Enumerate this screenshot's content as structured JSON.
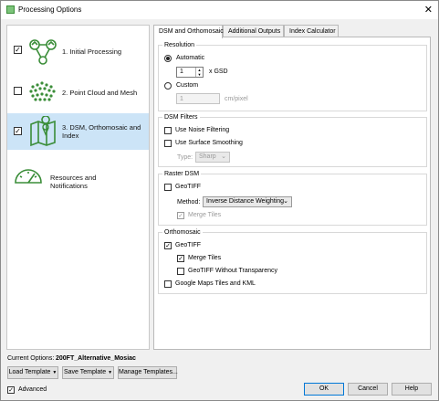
{
  "window": {
    "title": "Processing Options",
    "close_label": "✕"
  },
  "sidebar": {
    "items": [
      {
        "label": "1. Initial Processing",
        "checked": "✓"
      },
      {
        "label": "2. Point Cloud and Mesh",
        "checked": ""
      },
      {
        "label": "3. DSM, Orthomosaic and Index",
        "checked": "✓"
      },
      {
        "label": "Resources and Notifications"
      }
    ]
  },
  "tabs": [
    {
      "label": "DSM and Orthomosaic"
    },
    {
      "label": "Additional Outputs"
    },
    {
      "label": "Index Calculator"
    }
  ],
  "resolution": {
    "title": "Resolution",
    "automatic_label": "Automatic",
    "gsd_value": "1",
    "gsd_unit": "x GSD",
    "custom_label": "Custom",
    "custom_value": "1",
    "custom_unit": "cm/pixel"
  },
  "dsm_filters": {
    "title": "DSM Filters",
    "noise_label": "Use Noise Filtering",
    "smoothing_label": "Use Surface Smoothing",
    "type_label": "Type:",
    "type_value": "Sharp"
  },
  "raster_dsm": {
    "title": "Raster DSM",
    "geotiff_label": "GeoTIFF",
    "method_label": "Method:",
    "method_value": "Inverse Distance Weighting",
    "merge_label": "Merge Tiles"
  },
  "orthomosaic": {
    "title": "Orthomosaic",
    "geotiff_label": "GeoTIFF",
    "merge_label": "Merge Tiles",
    "no_transparency_label": "GeoTIFF Without Transparency",
    "google_label": "Google Maps Tiles and KML"
  },
  "footer": {
    "current_options_label": "Current Options:",
    "current_options_value": "200FT_Alternative_Mosiac",
    "load_template": "Load Template",
    "save_template": "Save Template",
    "manage_templates": "Manage Templates...",
    "advanced_label": "Advanced",
    "ok": "OK",
    "cancel": "Cancel",
    "help": "Help"
  },
  "colors": {
    "selection": "#cce4f7",
    "icon_green": "#3a8d38",
    "primary_border": "#0078d7"
  }
}
